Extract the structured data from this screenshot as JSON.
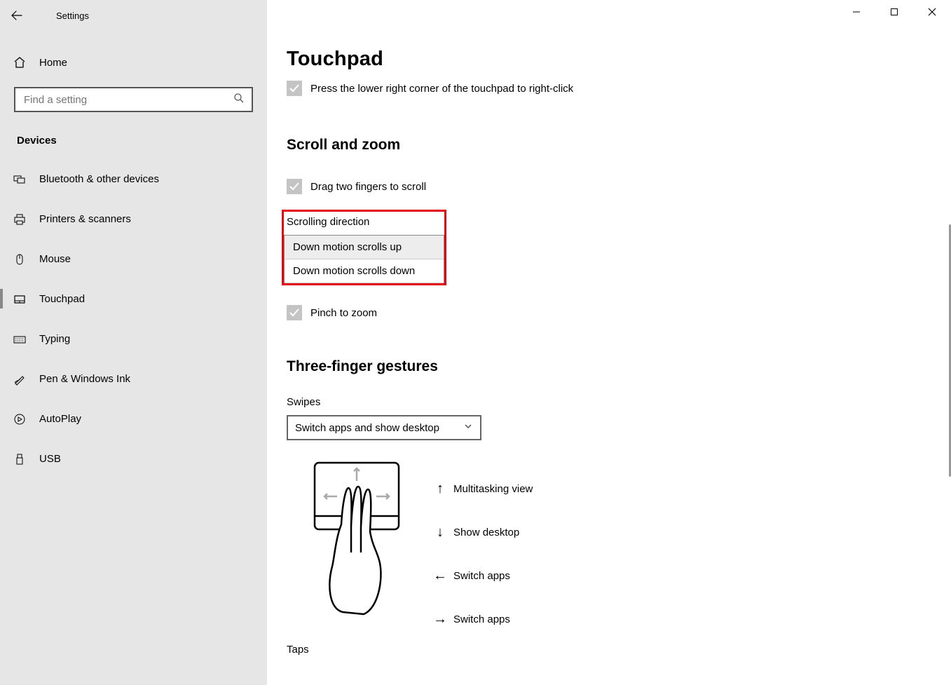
{
  "app_title": "Settings",
  "home_label": "Home",
  "search_placeholder": "Find a setting",
  "category_label": "Devices",
  "sidebar_items": {
    "bluetooth": "Bluetooth & other devices",
    "printers": "Printers & scanners",
    "mouse": "Mouse",
    "touchpad": "Touchpad",
    "typing": "Typing",
    "pen": "Pen & Windows Ink",
    "autoplay": "AutoPlay",
    "usb": "USB"
  },
  "page_title": "Touchpad",
  "right_click_label": "Press the lower right corner of the touchpad to right-click",
  "scroll_zoom_heading": "Scroll and zoom",
  "drag_scroll_label": "Drag two fingers to scroll",
  "scrolling_direction": {
    "label": "Scrolling direction",
    "option1": "Down motion scrolls up",
    "option2": "Down motion scrolls down"
  },
  "pinch_label": "Pinch to zoom",
  "three_finger_heading": "Three-finger gestures",
  "swipes_label": "Swipes",
  "swipes_selected": "Switch apps and show desktop",
  "gestures": {
    "up": "Multitasking view",
    "down": "Show desktop",
    "left": "Switch apps",
    "right": "Switch apps"
  },
  "taps_label": "Taps"
}
